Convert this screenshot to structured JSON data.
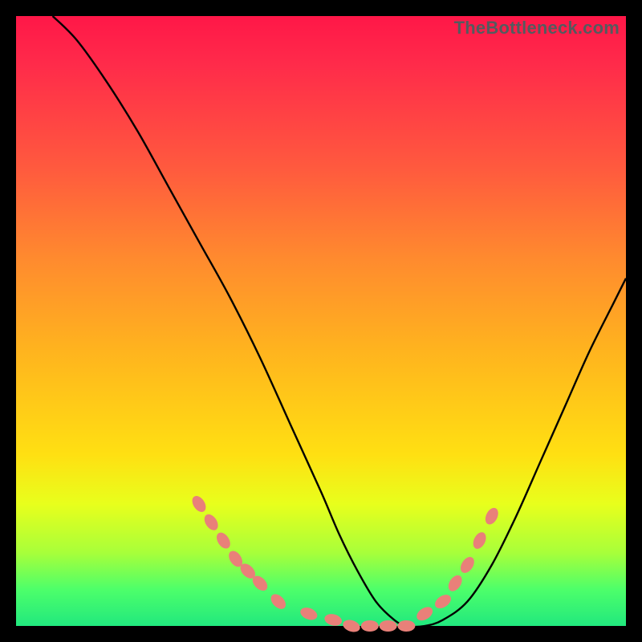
{
  "watermark": "TheBottleneck.com",
  "colors": {
    "background": "#000000",
    "curve": "#000000",
    "dots": "#e98079",
    "gradient_stops": [
      "#ff1748",
      "#ff5a3e",
      "#ffb41e",
      "#ffe012",
      "#4dff6a",
      "#21e87e"
    ]
  },
  "chart_data": {
    "type": "line",
    "title": "",
    "xlabel": "",
    "ylabel": "",
    "xlim": [
      0,
      100
    ],
    "ylim": [
      0,
      100
    ],
    "x": [
      6,
      10,
      15,
      20,
      25,
      30,
      35,
      40,
      45,
      50,
      53,
      56,
      59,
      62,
      64,
      67,
      70,
      74,
      78,
      82,
      86,
      90,
      94,
      98,
      100
    ],
    "values": [
      100,
      96,
      89,
      81,
      72,
      63,
      54,
      44,
      33,
      22,
      15,
      9,
      4,
      1,
      0,
      0,
      1,
      4,
      10,
      18,
      27,
      36,
      45,
      53,
      57
    ],
    "highlighted_points": {
      "x": [
        30,
        32,
        34,
        36,
        38,
        40,
        43,
        48,
        52,
        55,
        58,
        61,
        64,
        67,
        70,
        72,
        74,
        76,
        78
      ],
      "y": [
        20,
        17,
        14,
        11,
        9,
        7,
        4,
        2,
        1,
        0,
        0,
        0,
        0,
        2,
        4,
        7,
        10,
        14,
        18
      ]
    }
  }
}
